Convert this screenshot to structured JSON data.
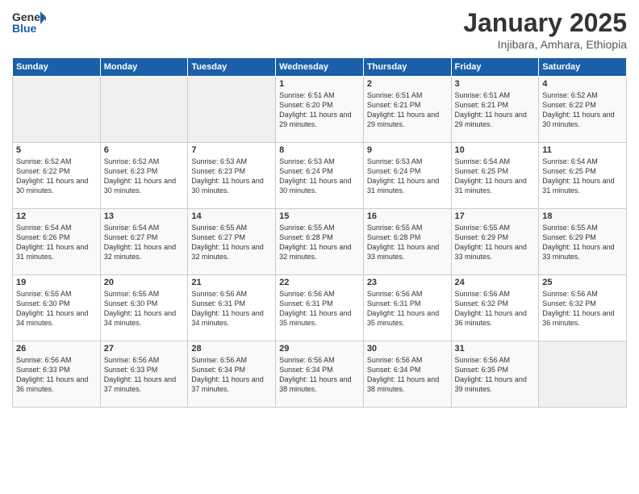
{
  "logo": {
    "general": "General",
    "blue": "Blue"
  },
  "header": {
    "month": "January 2025",
    "location": "Injibara, Amhara, Ethiopia"
  },
  "weekdays": [
    "Sunday",
    "Monday",
    "Tuesday",
    "Wednesday",
    "Thursday",
    "Friday",
    "Saturday"
  ],
  "weeks": [
    [
      {
        "day": "",
        "info": ""
      },
      {
        "day": "",
        "info": ""
      },
      {
        "day": "",
        "info": ""
      },
      {
        "day": "1",
        "info": "Sunrise: 6:51 AM\nSunset: 6:20 PM\nDaylight: 11 hours\nand 29 minutes."
      },
      {
        "day": "2",
        "info": "Sunrise: 6:51 AM\nSunset: 6:21 PM\nDaylight: 11 hours\nand 29 minutes."
      },
      {
        "day": "3",
        "info": "Sunrise: 6:51 AM\nSunset: 6:21 PM\nDaylight: 11 hours\nand 29 minutes."
      },
      {
        "day": "4",
        "info": "Sunrise: 6:52 AM\nSunset: 6:22 PM\nDaylight: 11 hours\nand 30 minutes."
      }
    ],
    [
      {
        "day": "5",
        "info": "Sunrise: 6:52 AM\nSunset: 6:22 PM\nDaylight: 11 hours\nand 30 minutes."
      },
      {
        "day": "6",
        "info": "Sunrise: 6:52 AM\nSunset: 6:23 PM\nDaylight: 11 hours\nand 30 minutes."
      },
      {
        "day": "7",
        "info": "Sunrise: 6:53 AM\nSunset: 6:23 PM\nDaylight: 11 hours\nand 30 minutes."
      },
      {
        "day": "8",
        "info": "Sunrise: 6:53 AM\nSunset: 6:24 PM\nDaylight: 11 hours\nand 30 minutes."
      },
      {
        "day": "9",
        "info": "Sunrise: 6:53 AM\nSunset: 6:24 PM\nDaylight: 11 hours\nand 31 minutes."
      },
      {
        "day": "10",
        "info": "Sunrise: 6:54 AM\nSunset: 6:25 PM\nDaylight: 11 hours\nand 31 minutes."
      },
      {
        "day": "11",
        "info": "Sunrise: 6:54 AM\nSunset: 6:25 PM\nDaylight: 11 hours\nand 31 minutes."
      }
    ],
    [
      {
        "day": "12",
        "info": "Sunrise: 6:54 AM\nSunset: 6:26 PM\nDaylight: 11 hours\nand 31 minutes."
      },
      {
        "day": "13",
        "info": "Sunrise: 6:54 AM\nSunset: 6:27 PM\nDaylight: 11 hours\nand 32 minutes."
      },
      {
        "day": "14",
        "info": "Sunrise: 6:55 AM\nSunset: 6:27 PM\nDaylight: 11 hours\nand 32 minutes."
      },
      {
        "day": "15",
        "info": "Sunrise: 6:55 AM\nSunset: 6:28 PM\nDaylight: 11 hours\nand 32 minutes."
      },
      {
        "day": "16",
        "info": "Sunrise: 6:55 AM\nSunset: 6:28 PM\nDaylight: 11 hours\nand 33 minutes."
      },
      {
        "day": "17",
        "info": "Sunrise: 6:55 AM\nSunset: 6:29 PM\nDaylight: 11 hours\nand 33 minutes."
      },
      {
        "day": "18",
        "info": "Sunrise: 6:55 AM\nSunset: 6:29 PM\nDaylight: 11 hours\nand 33 minutes."
      }
    ],
    [
      {
        "day": "19",
        "info": "Sunrise: 6:55 AM\nSunset: 6:30 PM\nDaylight: 11 hours\nand 34 minutes."
      },
      {
        "day": "20",
        "info": "Sunrise: 6:55 AM\nSunset: 6:30 PM\nDaylight: 11 hours\nand 34 minutes."
      },
      {
        "day": "21",
        "info": "Sunrise: 6:56 AM\nSunset: 6:31 PM\nDaylight: 11 hours\nand 34 minutes."
      },
      {
        "day": "22",
        "info": "Sunrise: 6:56 AM\nSunset: 6:31 PM\nDaylight: 11 hours\nand 35 minutes."
      },
      {
        "day": "23",
        "info": "Sunrise: 6:56 AM\nSunset: 6:31 PM\nDaylight: 11 hours\nand 35 minutes."
      },
      {
        "day": "24",
        "info": "Sunrise: 6:56 AM\nSunset: 6:32 PM\nDaylight: 11 hours\nand 36 minutes."
      },
      {
        "day": "25",
        "info": "Sunrise: 6:56 AM\nSunset: 6:32 PM\nDaylight: 11 hours\nand 36 minutes."
      }
    ],
    [
      {
        "day": "26",
        "info": "Sunrise: 6:56 AM\nSunset: 6:33 PM\nDaylight: 11 hours\nand 36 minutes."
      },
      {
        "day": "27",
        "info": "Sunrise: 6:56 AM\nSunset: 6:33 PM\nDaylight: 11 hours\nand 37 minutes."
      },
      {
        "day": "28",
        "info": "Sunrise: 6:56 AM\nSunset: 6:34 PM\nDaylight: 11 hours\nand 37 minutes."
      },
      {
        "day": "29",
        "info": "Sunrise: 6:56 AM\nSunset: 6:34 PM\nDaylight: 11 hours\nand 38 minutes."
      },
      {
        "day": "30",
        "info": "Sunrise: 6:56 AM\nSunset: 6:34 PM\nDaylight: 11 hours\nand 38 minutes."
      },
      {
        "day": "31",
        "info": "Sunrise: 6:56 AM\nSunset: 6:35 PM\nDaylight: 11 hours\nand 39 minutes."
      },
      {
        "day": "",
        "info": ""
      }
    ]
  ]
}
